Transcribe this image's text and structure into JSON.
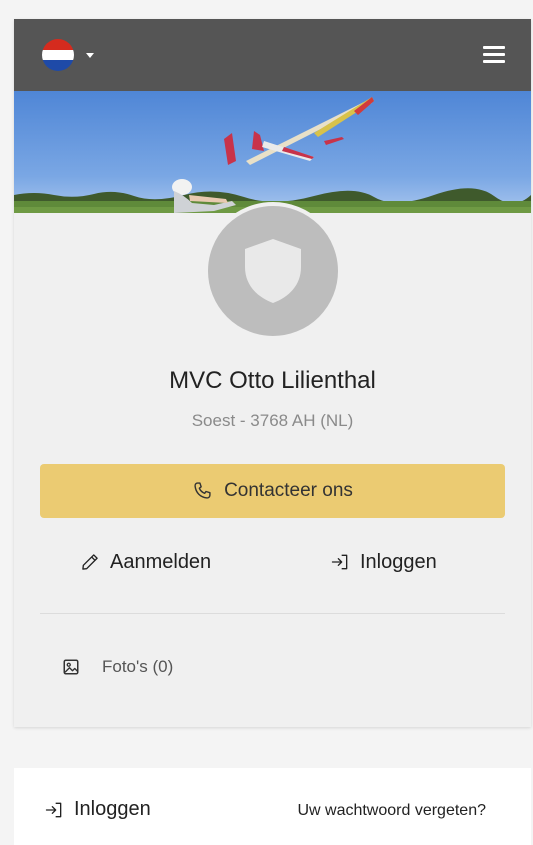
{
  "header": {
    "language_flag": "netherlands-flag",
    "language_caret": "caret-down-icon",
    "menu_icon": "hamburger-menu-icon"
  },
  "club": {
    "name": "MVC Otto Lilienthal",
    "location": "Soest - 3768 AH (NL)"
  },
  "actions": {
    "contact_label": "Contacteer ons",
    "register_label": "Aanmelden",
    "login_label": "Inloggen"
  },
  "photos": {
    "label": "Foto's (0)"
  },
  "footer": {
    "login_label": "Inloggen",
    "forgot_label": "Uw wachtwoord vergeten?"
  },
  "colors": {
    "topbar": "#555555",
    "contact_button": "#ebcb72",
    "avatar": "#bdbdbd"
  }
}
